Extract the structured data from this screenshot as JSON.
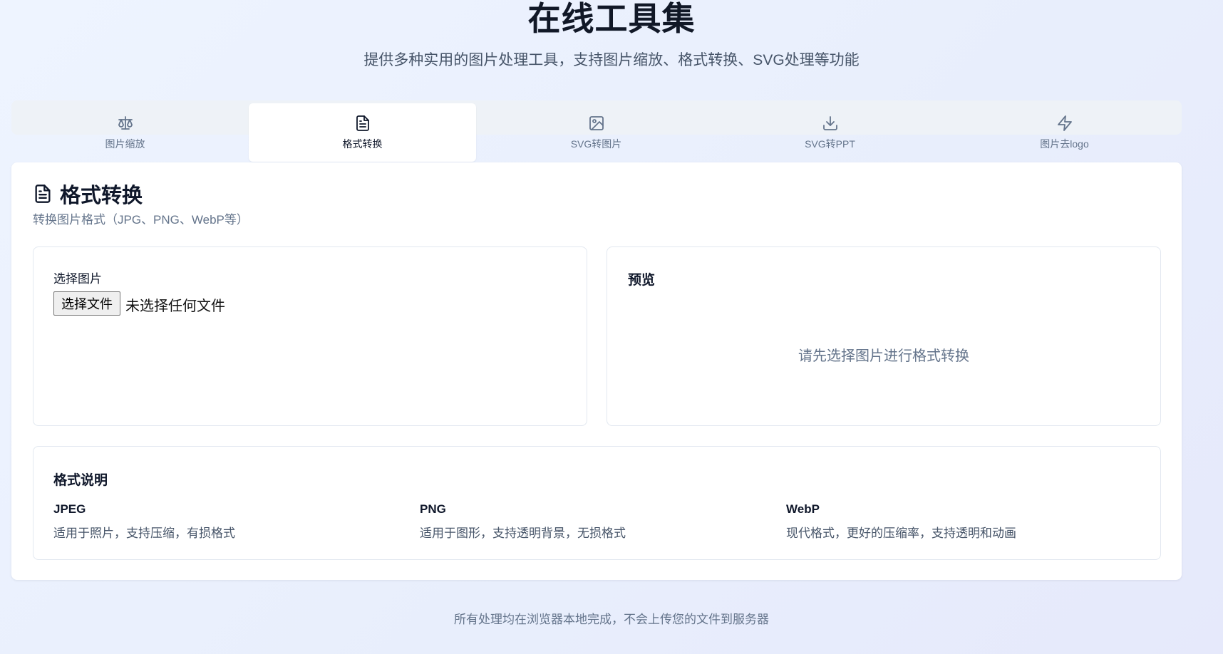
{
  "header": {
    "title": "在线工具集",
    "subtitle": "提供多种实用的图片处理工具，支持图片缩放、格式转换、SVG处理等功能"
  },
  "tabs": [
    {
      "label": "图片缩放",
      "icon": "scale-icon",
      "active": false
    },
    {
      "label": "格式转换",
      "icon": "file-text-icon",
      "active": true
    },
    {
      "label": "SVG转图片",
      "icon": "image-icon",
      "active": false
    },
    {
      "label": "SVG转PPT",
      "icon": "download-icon",
      "active": false
    },
    {
      "label": "图片去logo",
      "icon": "zap-icon",
      "active": false
    }
  ],
  "card": {
    "title": "格式转换",
    "title_icon": "file-text-icon",
    "description": "转换图片格式（JPG、PNG、WebP等）"
  },
  "upload": {
    "label": "选择图片",
    "button_label": "选择文件",
    "status": "未选择任何文件"
  },
  "preview": {
    "title": "预览",
    "empty_text": "请先选择图片进行格式转换"
  },
  "formats": {
    "title": "格式说明",
    "items": [
      {
        "name": "JPEG",
        "desc": "适用于照片，支持压缩，有损格式"
      },
      {
        "name": "PNG",
        "desc": "适用于图形，支持透明背景，无损格式"
      },
      {
        "name": "WebP",
        "desc": "现代格式，更好的压缩率，支持透明和动画"
      }
    ]
  },
  "footer": {
    "text": "所有处理均在浏览器本地完成，不会上传您的文件到服务器"
  },
  "colors": {
    "accent_text": "#0f172a",
    "muted_text": "#64748b",
    "tab_bar_bg": "#eef2f7",
    "card_bg": "#ffffff"
  }
}
